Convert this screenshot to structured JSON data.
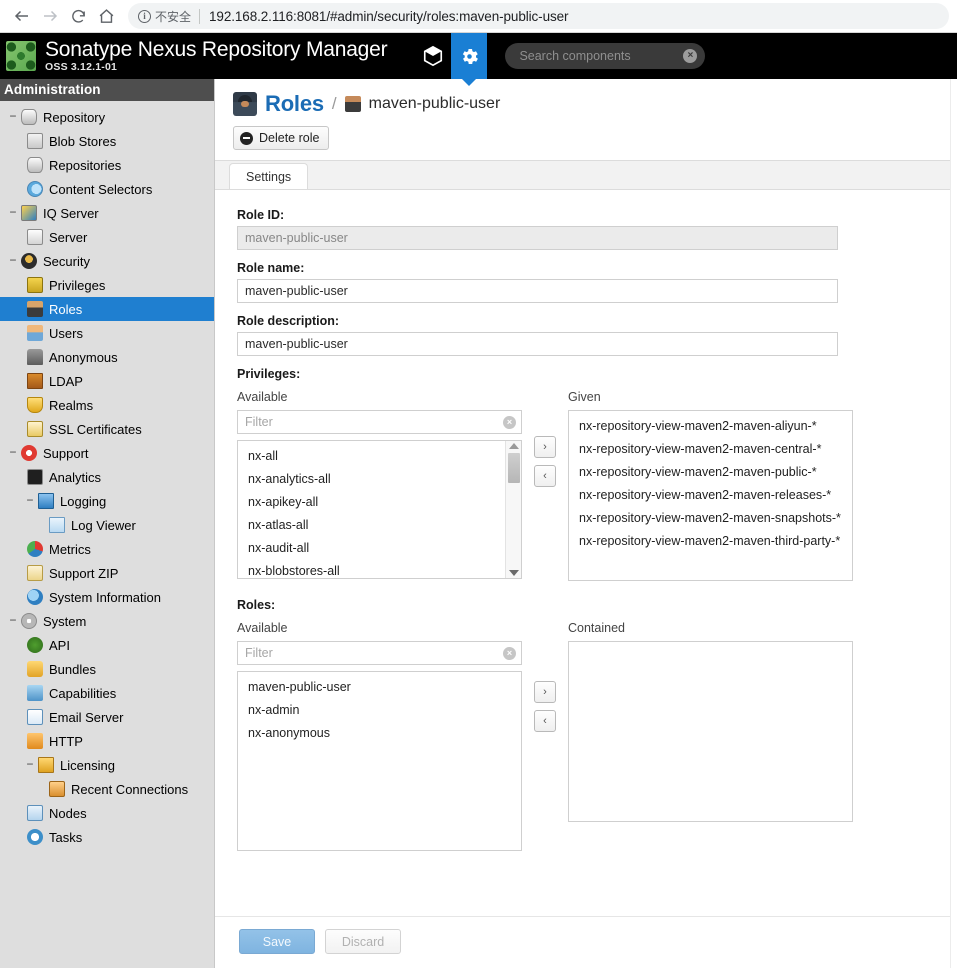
{
  "browser": {
    "security_label": "不安全",
    "security_icon": "info-circle-icon",
    "url": "192.168.2.116:8081/#admin/security/roles:maven-public-user",
    "back_icon": "back-arrow-icon",
    "forward_icon": "forward-arrow-icon",
    "reload_icon": "reload-icon",
    "home_icon": "home-icon"
  },
  "header": {
    "logo_icon": "nexus-logo-icon",
    "title": "Sonatype Nexus Repository Manager",
    "version": "OSS 3.12.1-01",
    "modes": [
      {
        "icon": "browse-cube-icon",
        "active": false
      },
      {
        "icon": "gear-icon",
        "active": true
      }
    ],
    "search": {
      "placeholder": "Search components",
      "clear_icon": "clear-x-icon"
    }
  },
  "sidebar": {
    "title": "Administration",
    "items": [
      {
        "label": "Repository",
        "level": 0,
        "expander": "−",
        "icon": "database-icon",
        "selected": false
      },
      {
        "label": "Blob Stores",
        "level": 1,
        "expander": "",
        "icon": "blobstore-icon",
        "selected": false
      },
      {
        "label": "Repositories",
        "level": 1,
        "expander": "",
        "icon": "repositories-icon",
        "selected": false
      },
      {
        "label": "Content Selectors",
        "level": 1,
        "expander": "",
        "icon": "content-selector-icon",
        "selected": false
      },
      {
        "label": "IQ Server",
        "level": 0,
        "expander": "−",
        "icon": "iq-server-icon",
        "selected": false
      },
      {
        "label": "Server",
        "level": 1,
        "expander": "",
        "icon": "server-icon",
        "selected": false
      },
      {
        "label": "Security",
        "level": 0,
        "expander": "−",
        "icon": "security-icon",
        "selected": false
      },
      {
        "label": "Privileges",
        "level": 1,
        "expander": "",
        "icon": "privileges-icon",
        "selected": false
      },
      {
        "label": "Roles",
        "level": 1,
        "expander": "",
        "icon": "roles-icon",
        "selected": true
      },
      {
        "label": "Users",
        "level": 1,
        "expander": "",
        "icon": "users-icon",
        "selected": false
      },
      {
        "label": "Anonymous",
        "level": 1,
        "expander": "",
        "icon": "anonymous-icon",
        "selected": false
      },
      {
        "label": "LDAP",
        "level": 1,
        "expander": "",
        "icon": "ldap-icon",
        "selected": false
      },
      {
        "label": "Realms",
        "level": 1,
        "expander": "",
        "icon": "realms-icon",
        "selected": false
      },
      {
        "label": "SSL Certificates",
        "level": 1,
        "expander": "",
        "icon": "ssl-certificates-icon",
        "selected": false
      },
      {
        "label": "Support",
        "level": 0,
        "expander": "−",
        "icon": "support-icon",
        "selected": false
      },
      {
        "label": "Analytics",
        "level": 1,
        "expander": "",
        "icon": "analytics-icon",
        "selected": false
      },
      {
        "label": "Logging",
        "level": 1,
        "expander": "−",
        "icon": "logging-icon",
        "selected": false
      },
      {
        "label": "Log Viewer",
        "level": 2,
        "expander": "",
        "icon": "log-viewer-icon",
        "selected": false
      },
      {
        "label": "Metrics",
        "level": 1,
        "expander": "",
        "icon": "metrics-icon",
        "selected": false
      },
      {
        "label": "Support ZIP",
        "level": 1,
        "expander": "",
        "icon": "support-zip-icon",
        "selected": false
      },
      {
        "label": "System Information",
        "level": 1,
        "expander": "",
        "icon": "system-information-icon",
        "selected": false
      },
      {
        "label": "System",
        "level": 0,
        "expander": "−",
        "icon": "system-icon",
        "selected": false
      },
      {
        "label": "API",
        "level": 1,
        "expander": "",
        "icon": "api-icon",
        "selected": false
      },
      {
        "label": "Bundles",
        "level": 1,
        "expander": "",
        "icon": "bundles-icon",
        "selected": false
      },
      {
        "label": "Capabilities",
        "level": 1,
        "expander": "",
        "icon": "capabilities-icon",
        "selected": false
      },
      {
        "label": "Email Server",
        "level": 1,
        "expander": "",
        "icon": "email-icon",
        "selected": false
      },
      {
        "label": "HTTP",
        "level": 1,
        "expander": "",
        "icon": "http-icon",
        "selected": false
      },
      {
        "label": "Licensing",
        "level": 1,
        "expander": "−",
        "icon": "licensing-icon",
        "selected": false
      },
      {
        "label": "Recent Connections",
        "level": 2,
        "expander": "",
        "icon": "recent-connections-icon",
        "selected": false
      },
      {
        "label": "Nodes",
        "level": 1,
        "expander": "",
        "icon": "nodes-icon",
        "selected": false
      },
      {
        "label": "Tasks",
        "level": 1,
        "expander": "",
        "icon": "tasks-icon",
        "selected": false
      }
    ]
  },
  "page": {
    "breadcrumb_icon": "roles-badge-icon",
    "title": "Roles",
    "separator": "/",
    "sub_icon": "role-user-icon",
    "subtitle": "maven-public-user",
    "delete_button": "Delete role",
    "delete_icon": "minus-circle-icon",
    "tabs": [
      {
        "label": "Settings",
        "active": true
      }
    ]
  },
  "form": {
    "role_id": {
      "label": "Role ID:",
      "value": "maven-public-user",
      "readonly": true
    },
    "role_name": {
      "label": "Role name:",
      "value": "maven-public-user",
      "readonly": false
    },
    "role_description": {
      "label": "Role description:",
      "value": "maven-public-user",
      "readonly": false
    },
    "privileges": {
      "label": "Privileges:",
      "available_header": "Available",
      "given_header": "Given",
      "filter_placeholder": "Filter",
      "filter_value": "",
      "available": [
        "nx-all",
        "nx-analytics-all",
        "nx-apikey-all",
        "nx-atlas-all",
        "nx-audit-all",
        "nx-blobstores-all"
      ],
      "given": [
        "nx-repository-view-maven2-maven-aliyun-*",
        "nx-repository-view-maven2-maven-central-*",
        "nx-repository-view-maven2-maven-public-*",
        "nx-repository-view-maven2-maven-releases-*",
        "nx-repository-view-maven2-maven-snapshots-*",
        "nx-repository-view-maven2-maven-third-party-*"
      ],
      "add_button": "›",
      "remove_button": "‹"
    },
    "roles": {
      "label": "Roles:",
      "available_header": "Available",
      "contained_header": "Contained",
      "filter_placeholder": "Filter",
      "filter_value": "",
      "available": [
        "maven-public-user",
        "nx-admin",
        "nx-anonymous"
      ],
      "contained": [],
      "add_button": "›",
      "remove_button": "‹"
    },
    "save_button": "Save",
    "discard_button": "Discard"
  },
  "colors": {
    "accent_blue": "#1a7fd4",
    "selected_nav": "#1f7fd0",
    "header_black": "#000000",
    "sidebar_bg": "#dedede",
    "title_blue": "#1b6cb5"
  }
}
